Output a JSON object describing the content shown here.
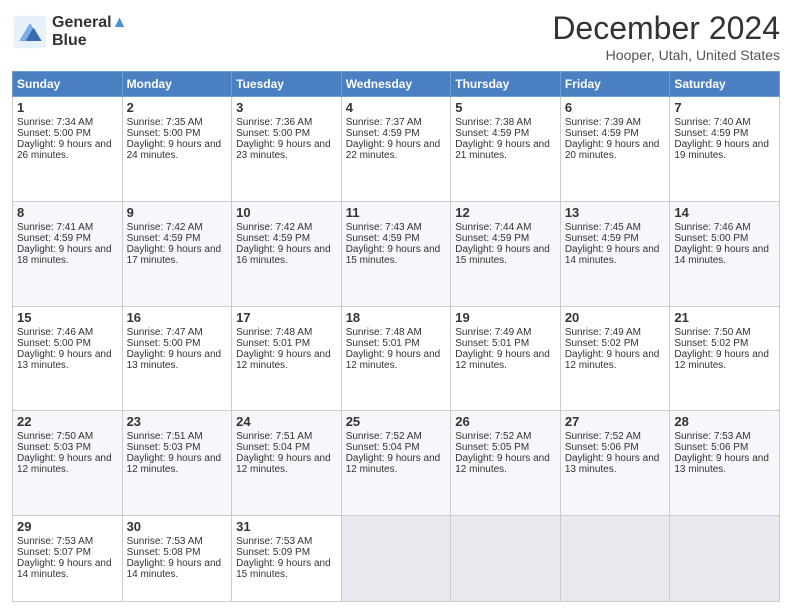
{
  "logo": {
    "line1": "General",
    "line2": "Blue"
  },
  "title": "December 2024",
  "location": "Hooper, Utah, United States",
  "days_header": [
    "Sunday",
    "Monday",
    "Tuesday",
    "Wednesday",
    "Thursday",
    "Friday",
    "Saturday"
  ],
  "weeks": [
    [
      {
        "day": "1",
        "sunrise": "Sunrise: 7:34 AM",
        "sunset": "Sunset: 5:00 PM",
        "daylight": "Daylight: 9 hours and 26 minutes."
      },
      {
        "day": "2",
        "sunrise": "Sunrise: 7:35 AM",
        "sunset": "Sunset: 5:00 PM",
        "daylight": "Daylight: 9 hours and 24 minutes."
      },
      {
        "day": "3",
        "sunrise": "Sunrise: 7:36 AM",
        "sunset": "Sunset: 5:00 PM",
        "daylight": "Daylight: 9 hours and 23 minutes."
      },
      {
        "day": "4",
        "sunrise": "Sunrise: 7:37 AM",
        "sunset": "Sunset: 4:59 PM",
        "daylight": "Daylight: 9 hours and 22 minutes."
      },
      {
        "day": "5",
        "sunrise": "Sunrise: 7:38 AM",
        "sunset": "Sunset: 4:59 PM",
        "daylight": "Daylight: 9 hours and 21 minutes."
      },
      {
        "day": "6",
        "sunrise": "Sunrise: 7:39 AM",
        "sunset": "Sunset: 4:59 PM",
        "daylight": "Daylight: 9 hours and 20 minutes."
      },
      {
        "day": "7",
        "sunrise": "Sunrise: 7:40 AM",
        "sunset": "Sunset: 4:59 PM",
        "daylight": "Daylight: 9 hours and 19 minutes."
      }
    ],
    [
      {
        "day": "8",
        "sunrise": "Sunrise: 7:41 AM",
        "sunset": "Sunset: 4:59 PM",
        "daylight": "Daylight: 9 hours and 18 minutes."
      },
      {
        "day": "9",
        "sunrise": "Sunrise: 7:42 AM",
        "sunset": "Sunset: 4:59 PM",
        "daylight": "Daylight: 9 hours and 17 minutes."
      },
      {
        "day": "10",
        "sunrise": "Sunrise: 7:42 AM",
        "sunset": "Sunset: 4:59 PM",
        "daylight": "Daylight: 9 hours and 16 minutes."
      },
      {
        "day": "11",
        "sunrise": "Sunrise: 7:43 AM",
        "sunset": "Sunset: 4:59 PM",
        "daylight": "Daylight: 9 hours and 15 minutes."
      },
      {
        "day": "12",
        "sunrise": "Sunrise: 7:44 AM",
        "sunset": "Sunset: 4:59 PM",
        "daylight": "Daylight: 9 hours and 15 minutes."
      },
      {
        "day": "13",
        "sunrise": "Sunrise: 7:45 AM",
        "sunset": "Sunset: 4:59 PM",
        "daylight": "Daylight: 9 hours and 14 minutes."
      },
      {
        "day": "14",
        "sunrise": "Sunrise: 7:46 AM",
        "sunset": "Sunset: 5:00 PM",
        "daylight": "Daylight: 9 hours and 14 minutes."
      }
    ],
    [
      {
        "day": "15",
        "sunrise": "Sunrise: 7:46 AM",
        "sunset": "Sunset: 5:00 PM",
        "daylight": "Daylight: 9 hours and 13 minutes."
      },
      {
        "day": "16",
        "sunrise": "Sunrise: 7:47 AM",
        "sunset": "Sunset: 5:00 PM",
        "daylight": "Daylight: 9 hours and 13 minutes."
      },
      {
        "day": "17",
        "sunrise": "Sunrise: 7:48 AM",
        "sunset": "Sunset: 5:01 PM",
        "daylight": "Daylight: 9 hours and 12 minutes."
      },
      {
        "day": "18",
        "sunrise": "Sunrise: 7:48 AM",
        "sunset": "Sunset: 5:01 PM",
        "daylight": "Daylight: 9 hours and 12 minutes."
      },
      {
        "day": "19",
        "sunrise": "Sunrise: 7:49 AM",
        "sunset": "Sunset: 5:01 PM",
        "daylight": "Daylight: 9 hours and 12 minutes."
      },
      {
        "day": "20",
        "sunrise": "Sunrise: 7:49 AM",
        "sunset": "Sunset: 5:02 PM",
        "daylight": "Daylight: 9 hours and 12 minutes."
      },
      {
        "day": "21",
        "sunrise": "Sunrise: 7:50 AM",
        "sunset": "Sunset: 5:02 PM",
        "daylight": "Daylight: 9 hours and 12 minutes."
      }
    ],
    [
      {
        "day": "22",
        "sunrise": "Sunrise: 7:50 AM",
        "sunset": "Sunset: 5:03 PM",
        "daylight": "Daylight: 9 hours and 12 minutes."
      },
      {
        "day": "23",
        "sunrise": "Sunrise: 7:51 AM",
        "sunset": "Sunset: 5:03 PM",
        "daylight": "Daylight: 9 hours and 12 minutes."
      },
      {
        "day": "24",
        "sunrise": "Sunrise: 7:51 AM",
        "sunset": "Sunset: 5:04 PM",
        "daylight": "Daylight: 9 hours and 12 minutes."
      },
      {
        "day": "25",
        "sunrise": "Sunrise: 7:52 AM",
        "sunset": "Sunset: 5:04 PM",
        "daylight": "Daylight: 9 hours and 12 minutes."
      },
      {
        "day": "26",
        "sunrise": "Sunrise: 7:52 AM",
        "sunset": "Sunset: 5:05 PM",
        "daylight": "Daylight: 9 hours and 12 minutes."
      },
      {
        "day": "27",
        "sunrise": "Sunrise: 7:52 AM",
        "sunset": "Sunset: 5:06 PM",
        "daylight": "Daylight: 9 hours and 13 minutes."
      },
      {
        "day": "28",
        "sunrise": "Sunrise: 7:53 AM",
        "sunset": "Sunset: 5:06 PM",
        "daylight": "Daylight: 9 hours and 13 minutes."
      }
    ],
    [
      {
        "day": "29",
        "sunrise": "Sunrise: 7:53 AM",
        "sunset": "Sunset: 5:07 PM",
        "daylight": "Daylight: 9 hours and 14 minutes."
      },
      {
        "day": "30",
        "sunrise": "Sunrise: 7:53 AM",
        "sunset": "Sunset: 5:08 PM",
        "daylight": "Daylight: 9 hours and 14 minutes."
      },
      {
        "day": "31",
        "sunrise": "Sunrise: 7:53 AM",
        "sunset": "Sunset: 5:09 PM",
        "daylight": "Daylight: 9 hours and 15 minutes."
      },
      {
        "day": "",
        "sunrise": "",
        "sunset": "",
        "daylight": ""
      },
      {
        "day": "",
        "sunrise": "",
        "sunset": "",
        "daylight": ""
      },
      {
        "day": "",
        "sunrise": "",
        "sunset": "",
        "daylight": ""
      },
      {
        "day": "",
        "sunrise": "",
        "sunset": "",
        "daylight": ""
      }
    ]
  ]
}
